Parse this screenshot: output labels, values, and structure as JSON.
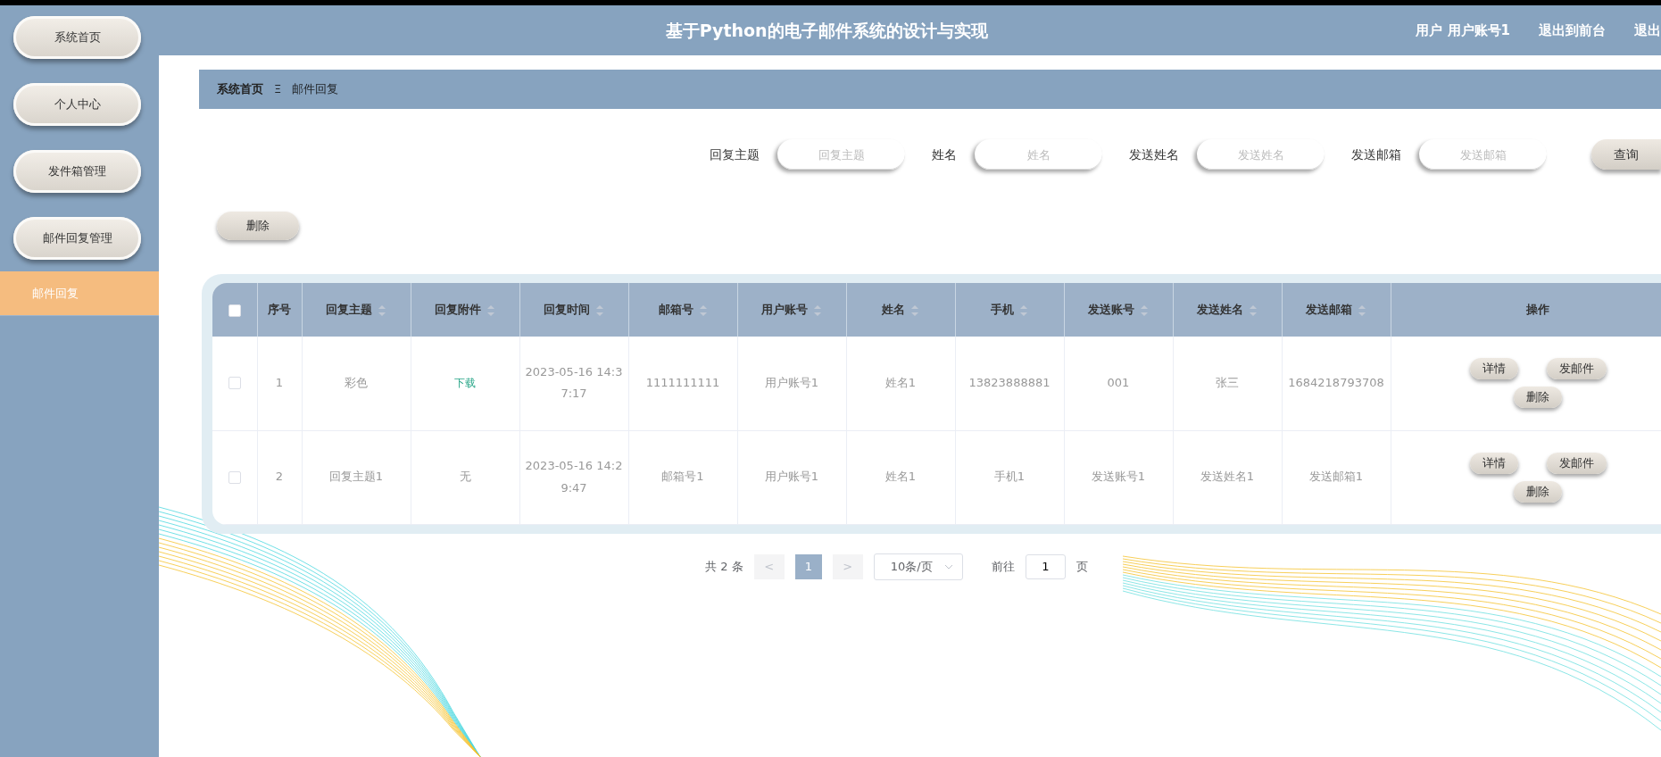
{
  "header": {
    "title": "基于Python的电子邮件系统的设计与实现",
    "links": [
      "用户 用户账号1",
      "退出到前台",
      "退出"
    ]
  },
  "sidebar": {
    "items": [
      {
        "label": "系统首页",
        "kind": "button",
        "selected": false
      },
      {
        "label": "个人中心",
        "kind": "button",
        "selected": false
      },
      {
        "label": "发件箱管理",
        "kind": "button",
        "selected": false
      },
      {
        "label": "邮件回复管理",
        "kind": "button",
        "selected": false
      },
      {
        "label": "邮件回复",
        "kind": "submenu",
        "selected": true
      }
    ]
  },
  "breadcrumb": {
    "home": "系统首页",
    "separator": "Ξ",
    "current": "邮件回复"
  },
  "search": {
    "fields": [
      {
        "label": "回复主题",
        "placeholder": "回复主题"
      },
      {
        "label": "姓名",
        "placeholder": "姓名"
      },
      {
        "label": "发送姓名",
        "placeholder": "发送姓名"
      },
      {
        "label": "发送邮箱",
        "placeholder": "发送邮箱"
      }
    ],
    "button": "查询"
  },
  "toolbar": {
    "delete_button": "删除"
  },
  "table": {
    "select_all_checked": false,
    "columns": [
      {
        "label": "序号",
        "sortable": false
      },
      {
        "label": "回复主题",
        "sortable": true
      },
      {
        "label": "回复附件",
        "sortable": true
      },
      {
        "label": "回复时间",
        "sortable": true
      },
      {
        "label": "邮箱号",
        "sortable": true
      },
      {
        "label": "用户账号",
        "sortable": true
      },
      {
        "label": "姓名",
        "sortable": true
      },
      {
        "label": "手机",
        "sortable": true
      },
      {
        "label": "发送账号",
        "sortable": true
      },
      {
        "label": "发送姓名",
        "sortable": true
      },
      {
        "label": "发送邮箱",
        "sortable": true
      },
      {
        "label": "操作",
        "sortable": false
      }
    ],
    "rows": [
      {
        "checked": false,
        "cells": [
          {
            "kind": "text",
            "text": "1"
          },
          {
            "kind": "text",
            "text": "彩色"
          },
          {
            "kind": "link",
            "text": "下载"
          },
          {
            "kind": "text",
            "text": "2023-05-16 14:37:17"
          },
          {
            "kind": "text",
            "text": "1111111111"
          },
          {
            "kind": "text",
            "text": "用户账号1"
          },
          {
            "kind": "text",
            "text": "姓名1"
          },
          {
            "kind": "text",
            "text": "13823888881"
          },
          {
            "kind": "text",
            "text": "001"
          },
          {
            "kind": "text",
            "text": "张三"
          },
          {
            "kind": "text",
            "text": "1684218793708"
          }
        ],
        "actions": [
          "详情",
          "发邮件",
          "删除"
        ]
      },
      {
        "checked": false,
        "cells": [
          {
            "kind": "text",
            "text": "2"
          },
          {
            "kind": "text",
            "text": "回复主题1"
          },
          {
            "kind": "text",
            "text": "无"
          },
          {
            "kind": "text",
            "text": "2023-05-16 14:29:47"
          },
          {
            "kind": "text",
            "text": "邮箱号1"
          },
          {
            "kind": "text",
            "text": "用户账号1"
          },
          {
            "kind": "text",
            "text": "姓名1"
          },
          {
            "kind": "text",
            "text": "手机1"
          },
          {
            "kind": "text",
            "text": "发送账号1"
          },
          {
            "kind": "text",
            "text": "发送姓名1"
          },
          {
            "kind": "text",
            "text": "发送邮箱1"
          }
        ],
        "actions": [
          "详情",
          "发邮件",
          "删除"
        ]
      }
    ]
  },
  "pagination": {
    "total": "共 2 条",
    "prev": "<",
    "pages": [
      {
        "label": "1",
        "selected": true
      }
    ],
    "next": ">",
    "page_size": "10条/页",
    "goto_label": "前往",
    "goto_value": "1",
    "goto_suffix": "页"
  }
}
